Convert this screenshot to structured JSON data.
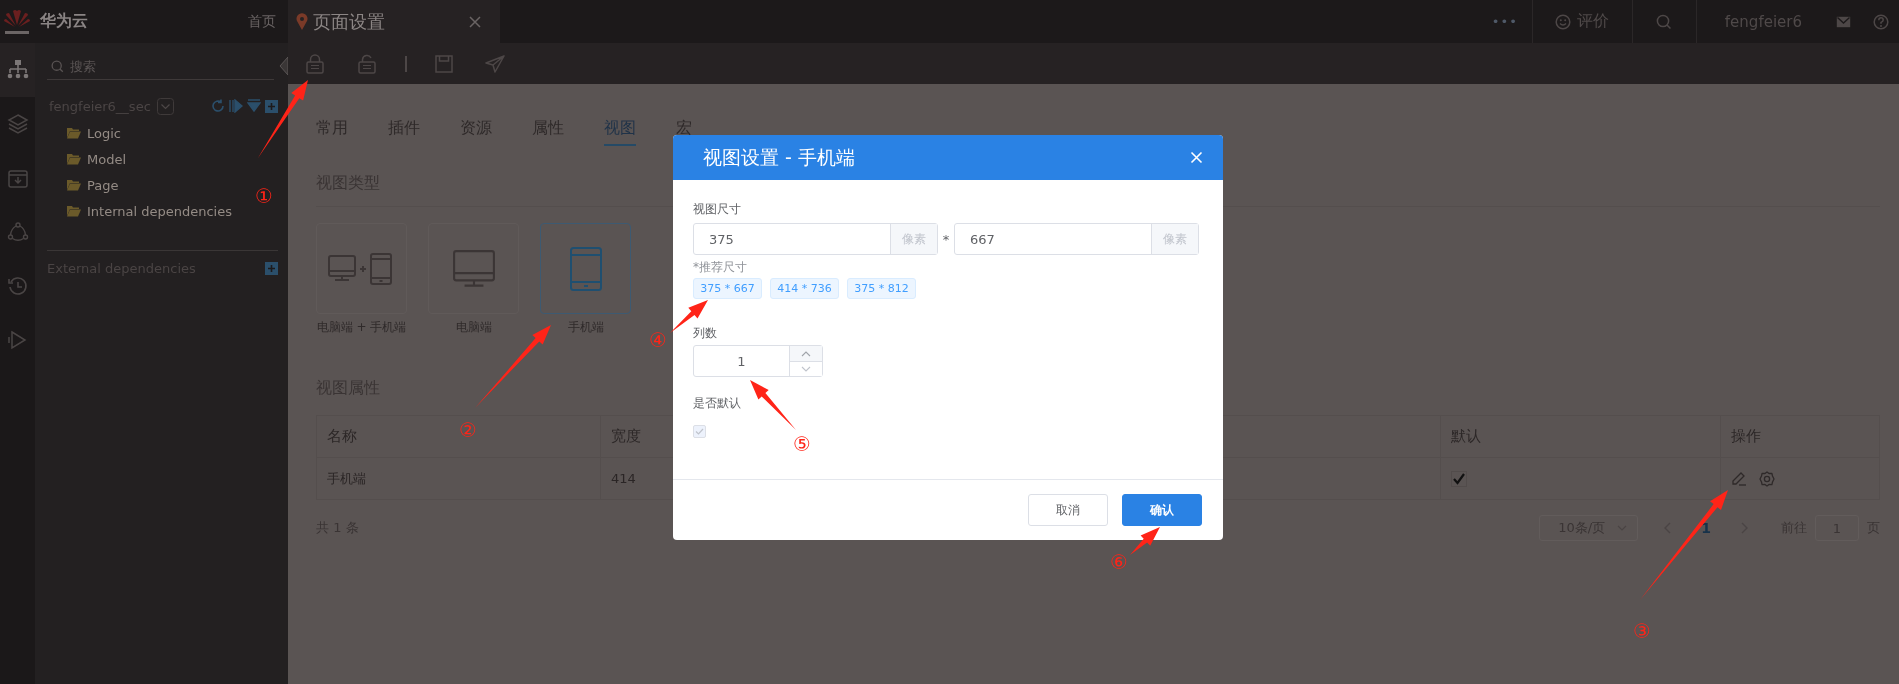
{
  "topbar": {
    "brand": "华为云",
    "home_link": "首页",
    "page_tab": {
      "title": "页面设置"
    },
    "more": "•••",
    "rate": "评价",
    "user": "fengfeier6"
  },
  "rail": [
    {
      "selected": true
    },
    {
      "selected": false
    },
    {
      "selected": false
    },
    {
      "selected": false
    },
    {
      "selected": false
    },
    {
      "selected": false
    }
  ],
  "sidebar": {
    "search_placeholder": "搜索",
    "project": "fengfeier6__sec",
    "tree": [
      {
        "label": "Logic"
      },
      {
        "label": "Model"
      },
      {
        "label": "Page"
      },
      {
        "label": "Internal dependencies"
      }
    ],
    "external": "External dependencies"
  },
  "tabs": [
    {
      "label": "常用",
      "selected": false
    },
    {
      "label": "插件",
      "selected": false
    },
    {
      "label": "资源",
      "selected": false
    },
    {
      "label": "属性",
      "selected": false
    },
    {
      "label": "视图",
      "selected": true
    },
    {
      "label": "宏",
      "selected": false
    }
  ],
  "view_types": {
    "title": "视图类型",
    "options": [
      {
        "label": "电脑端 + 手机端",
        "kind": "both",
        "selected": false
      },
      {
        "label": "电脑端",
        "kind": "desktop",
        "selected": false
      },
      {
        "label": "手机端",
        "kind": "mobile",
        "selected": true
      }
    ]
  },
  "view_properties": {
    "title": "视图属性",
    "columns": [
      "名称",
      "宽度",
      "默认",
      "操作"
    ],
    "rows": [
      {
        "cells": [
          "手机端",
          "414"
        ],
        "default": true
      }
    ]
  },
  "pagination": {
    "total": "共 1 条",
    "page_size": "10条/页",
    "current": "1",
    "goto_label": "前往",
    "goto_value": "1",
    "goto_suffix": "页"
  },
  "dialog": {
    "title": "视图设置 - 手机端",
    "size_label": "视图尺寸",
    "width_value": "375",
    "width_unit": "像素",
    "times": "*",
    "height_value": "667",
    "height_unit": "像素",
    "recommended_label": "*推荐尺寸",
    "presets": [
      "375 * 667",
      "414 * 736",
      "375 * 812"
    ],
    "columns_label": "列数",
    "columns_value": "1",
    "default_label": "是否默认",
    "default_checked": true,
    "default_disabled": true,
    "cancel": "取消",
    "confirm": "确认"
  },
  "annotations": [
    "①",
    "②",
    "③",
    "④",
    "⑤",
    "⑥"
  ]
}
